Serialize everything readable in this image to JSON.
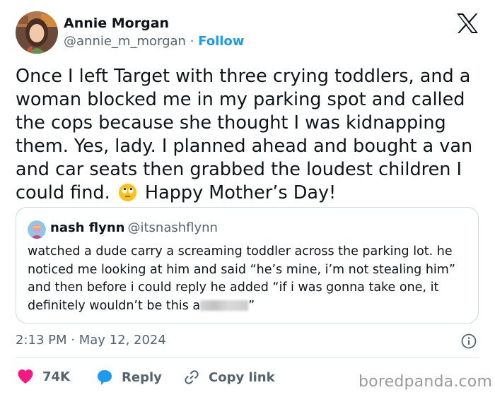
{
  "author": {
    "name": "Annie Morgan",
    "handle": "@annie_m_morgan",
    "separator": "·",
    "follow_label": "Follow"
  },
  "platform_icon": "x-logo-icon",
  "tweet": {
    "text_before_emoji": "Once I left Target with three crying toddlers, and a woman blocked me in my parking spot and called the cops because she thought I was kidnapping them. Yes, lady. I planned ahead and bought a van and car seats then grabbed the loudest children I could find.",
    "emoji": "face-with-rolling-eyes-emoji",
    "text_after_emoji": "Happy Mother’s Day!"
  },
  "quoted_tweet": {
    "name": "nash flynn",
    "handle": "@itsnashflynn",
    "text": "watched a dude carry a screaming toddler across the parking lot. he noticed me looking at him and said “he’s mine, i’m not stealing him” and then before i could reply he added “if i was gonna take one, it definitely wouldn’t be this a",
    "text_end": "”"
  },
  "timestamp": {
    "time": "2:13 PM",
    "separator": "·",
    "date": "May 12, 2024"
  },
  "actions": {
    "like_count": "74K",
    "reply_label": "Reply",
    "copy_link_label": "Copy link"
  },
  "watermark": "boredpanda.com",
  "colors": {
    "text": "#0f1419",
    "secondary": "#536471",
    "accent": "#1d9bf0",
    "like": "#f91880"
  }
}
